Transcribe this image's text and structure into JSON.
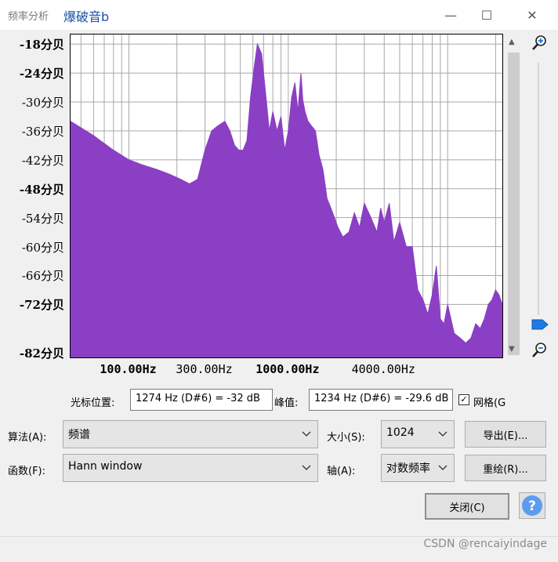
{
  "window": {
    "app_title": "频率分析",
    "doc_title": "爆破音b",
    "minimize_glyph": "—",
    "maximize_glyph": "☐",
    "close_glyph": "✕"
  },
  "plot": {
    "y_labels": [
      {
        "text": "-18分贝",
        "db": -18,
        "bold": true
      },
      {
        "text": "-24分贝",
        "db": -24,
        "bold": true
      },
      {
        "text": "-30分贝",
        "db": -30,
        "bold": false
      },
      {
        "text": "-36分贝",
        "db": -36,
        "bold": false
      },
      {
        "text": "-42分贝",
        "db": -42,
        "bold": false
      },
      {
        "text": "-48分贝",
        "db": -48,
        "bold": true
      },
      {
        "text": "-54分贝",
        "db": -54,
        "bold": false
      },
      {
        "text": "-60分贝",
        "db": -60,
        "bold": false
      },
      {
        "text": "-66分贝",
        "db": -66,
        "bold": false
      },
      {
        "text": "-72分贝",
        "db": -72,
        "bold": true
      },
      {
        "text": "-82分贝",
        "db": -82,
        "bold": true
      }
    ],
    "x_labels": [
      {
        "text": "100.00Hz",
        "hz": 100,
        "bold": true
      },
      {
        "text": "300.00Hz",
        "hz": 300,
        "bold": false
      },
      {
        "text": "1000.00Hz",
        "hz": 1000,
        "bold": true
      },
      {
        "text": "4000.00Hz",
        "hz": 4000,
        "bold": false
      }
    ],
    "fill_color": "#8a3fc4",
    "grid_color": "#a8a8a8",
    "grid": true
  },
  "chart_data": {
    "type": "area",
    "xscale": "log",
    "xlim": [
      43,
      22050
    ],
    "ylim": [
      -83,
      -16
    ],
    "ylabel": "分贝",
    "x": [
      43,
      60,
      80,
      100,
      120,
      150,
      180,
      210,
      240,
      270,
      300,
      330,
      360,
      400,
      430,
      460,
      490,
      520,
      550,
      580,
      610,
      640,
      680,
      720,
      760,
      800,
      850,
      900,
      950,
      1000,
      1050,
      1100,
      1150,
      1200,
      1234,
      1274,
      1330,
      1400,
      1480,
      1560,
      1650,
      1750,
      1850,
      1950,
      2050,
      2200,
      2400,
      2600,
      2800,
      3000,
      3300,
      3600,
      3800,
      4000,
      4300,
      4600,
      5000,
      5500,
      6000,
      6500,
      7000,
      7500,
      8000,
      8500,
      9000,
      9500,
      10000,
      11000,
      12000,
      13000,
      14000,
      15000,
      16000,
      17000,
      18000,
      19000,
      20000,
      21000,
      22050
    ],
    "values": [
      -34,
      -37,
      -40,
      -42,
      -43,
      -44,
      -45,
      -46,
      -47,
      -46,
      -40,
      -36,
      -35,
      -34,
      -36,
      -39,
      -40,
      -40,
      -38,
      -29,
      -23,
      -18,
      -20,
      -28,
      -36,
      -32,
      -36,
      -33,
      -40,
      -36,
      -29,
      -26,
      -32,
      -24,
      -29.6,
      -32,
      -34,
      -35,
      -36,
      -41,
      -44,
      -50,
      -52,
      -54,
      -56,
      -58,
      -57,
      -53,
      -56,
      -51,
      -54,
      -57,
      -52,
      -55,
      -51,
      -59,
      -55,
      -60,
      -60,
      -69,
      -71,
      -74,
      -70,
      -64,
      -75,
      -76,
      -72,
      -78,
      -79,
      -80,
      -79,
      -76,
      -77,
      -75,
      -72,
      -71,
      -69,
      -70,
      -72
    ]
  },
  "controls": {
    "cursor_label": "光标位置:",
    "cursor_value": "1274 Hz (D#6) = -32 dB",
    "peak_label": "峰值:",
    "peak_value": "1234 Hz (D#6) = -29.6 dB",
    "grid_label": "网格(G)",
    "grid_checked_glyph": "✓",
    "algorithm_label": "算法(A):",
    "algorithm_value": "频谱",
    "function_label": "函数(F):",
    "function_value": "Hann window",
    "size_label": "大小(S):",
    "size_value": "1024",
    "axis_label": "轴(A):",
    "axis_value": "对数频率",
    "export_label": "导出(E)...",
    "replot_label": "重绘(R)...",
    "close_label": "关闭(C)",
    "help_glyph": "?"
  },
  "watermark": "CSDN @rencaiyindage"
}
